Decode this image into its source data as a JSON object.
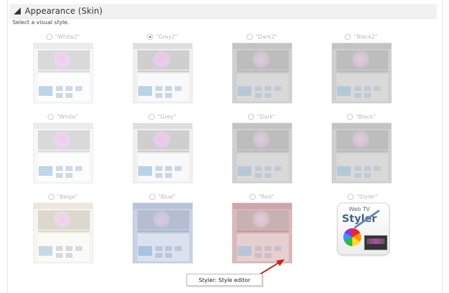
{
  "panel": {
    "title": "Appearance (Skin)",
    "subtitle": "Select a visual style."
  },
  "skins": [
    {
      "label": "\"White2\"",
      "checked": false,
      "theme": "light"
    },
    {
      "label": "\"Grey2\"",
      "checked": true,
      "theme": "grey"
    },
    {
      "label": "\"Dark2\"",
      "checked": false,
      "theme": "dark"
    },
    {
      "label": "\"Black2\"",
      "checked": false,
      "theme": "dark"
    },
    {
      "label": "\"White\"",
      "checked": false,
      "theme": "light"
    },
    {
      "label": "\"Grey\"",
      "checked": false,
      "theme": "grey"
    },
    {
      "label": "\"Dark\"",
      "checked": false,
      "theme": "dark"
    },
    {
      "label": "\"Black\"",
      "checked": false,
      "theme": "dark"
    },
    {
      "label": "\"Beige\"",
      "checked": false,
      "theme": "beige"
    },
    {
      "label": "\"Blue\"",
      "checked": false,
      "theme": "blue"
    },
    {
      "label": "\"Red\"",
      "checked": false,
      "theme": "red"
    },
    {
      "label": "\"Styler\"",
      "checked": false,
      "theme": "styler"
    }
  ],
  "styler_icon": {
    "line1": "Web TV",
    "line2": "Styler"
  },
  "tooltip": {
    "text": "Styler: Style editor"
  },
  "colors": {
    "arrow": "#cc1f1f"
  }
}
